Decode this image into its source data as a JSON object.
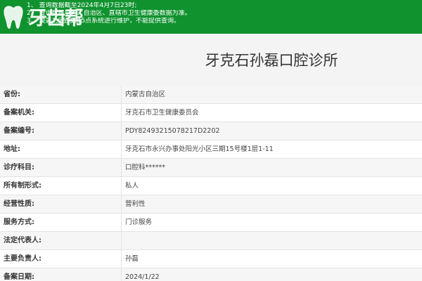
{
  "notice": {
    "lines": [
      "1、 查询数据截至2024年4月7日23时;",
      "2、 查询数据以省、自治区、直辖市卫生健康委数据为准。",
      "3、 凌晨1点至凌晨5点系统进行维护，不能提供查询。"
    ],
    "background_color": "#10932f"
  },
  "watermark": {
    "text": "牙齿帮",
    "icon": "tooth-icon"
  },
  "clinic": {
    "title": "牙克石孙磊口腔诊所"
  },
  "fields": [
    {
      "label": "省份:",
      "value": "内蒙古自治区"
    },
    {
      "label": "备案机关:",
      "value": "牙克石市卫生健康委员会"
    },
    {
      "label": "备案编号:",
      "value": "PDY82493215078217D2202"
    },
    {
      "label": "地址:",
      "value": "牙克石市永兴办事处阳光小区三期15号楼1层1-11"
    },
    {
      "label": "诊疗科目:",
      "value": "口腔科******"
    },
    {
      "label": "所有制形式:",
      "value": "私人"
    },
    {
      "label": "经营性质:",
      "value": "营利性"
    },
    {
      "label": "服务方式:",
      "value": "门诊服务"
    },
    {
      "label": "法定代表人:",
      "value": ""
    },
    {
      "label": "主要负责人:",
      "value": "孙磊"
    },
    {
      "label": "备案日期:",
      "value": "2024/1/22"
    }
  ]
}
